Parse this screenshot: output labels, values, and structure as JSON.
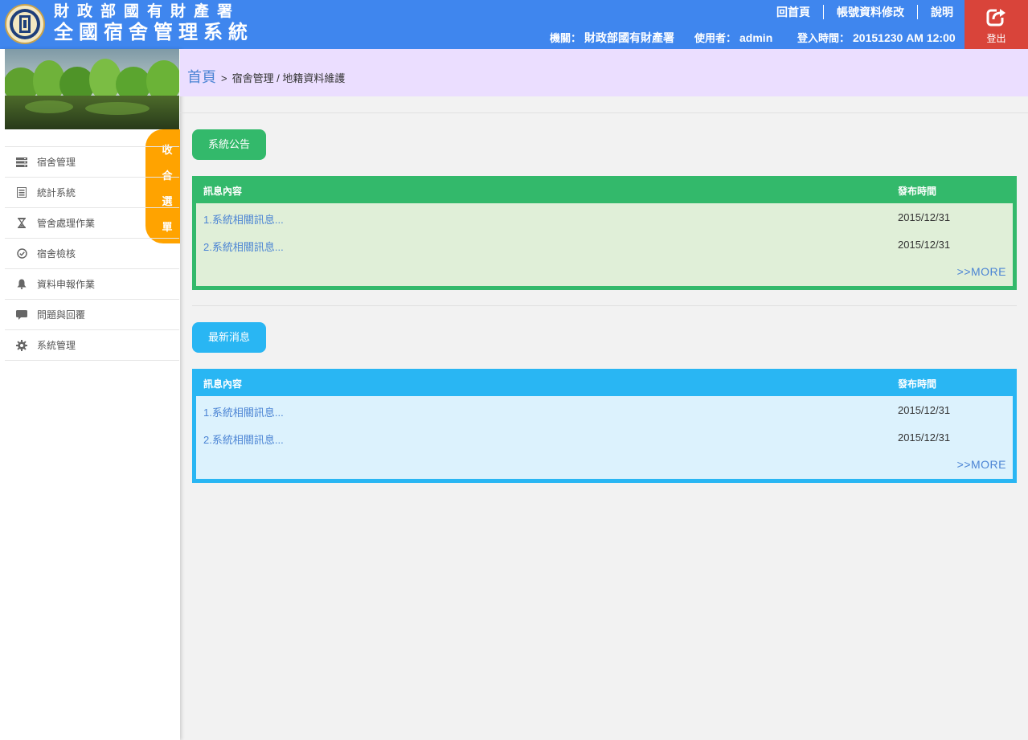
{
  "header": {
    "title_line1": "財政部國有財產署",
    "title_line2": "全國宿舍管理系統",
    "links": [
      "回首頁",
      "帳號資料修改",
      "說明"
    ],
    "agency_label": "機關：",
    "agency_value": "財政部國有財產署",
    "user_label": "使用者：",
    "user_value": "admin",
    "login_label": "登入時間：",
    "login_value": "20151230 AM 12:00",
    "logout_label": "登出"
  },
  "sidebar": {
    "toggle_chars": [
      "收",
      "合",
      "選",
      "單"
    ],
    "items": [
      {
        "label": "宿舍管理",
        "icon": "server-icon"
      },
      {
        "label": "統計系統",
        "icon": "list-icon"
      },
      {
        "label": "管舍處理作業",
        "icon": "hourglass-icon"
      },
      {
        "label": "宿舍檢核",
        "icon": "check-circle-icon"
      },
      {
        "label": "資料申報作業",
        "icon": "bell-icon"
      },
      {
        "label": "問題與回覆",
        "icon": "comment-icon"
      },
      {
        "label": "系統管理",
        "icon": "gear-icon"
      }
    ]
  },
  "breadcrumb": {
    "home": "首頁",
    "separator": ">",
    "path": "宿舍管理 / 地籍資料維護"
  },
  "announcements": {
    "button": "系統公告",
    "col_content": "訊息內容",
    "col_time": "發布時間",
    "rows": [
      {
        "content": "1.系統相關訊息...",
        "time": "2015/12/31"
      },
      {
        "content": "2.系統相關訊息...",
        "time": "2015/12/31"
      }
    ],
    "more": ">>MORE",
    "color": "#33b96b",
    "bg": "#e0efd8"
  },
  "news": {
    "button": "最新消息",
    "col_content": "訊息內容",
    "col_time": "發布時間",
    "rows": [
      {
        "content": "1.系統相關訊息...",
        "time": "2015/12/31"
      },
      {
        "content": "2.系統相關訊息...",
        "time": "2015/12/31"
      }
    ],
    "more": ">>MORE",
    "color": "#29b6f3",
    "bg": "#dcf2fd"
  }
}
